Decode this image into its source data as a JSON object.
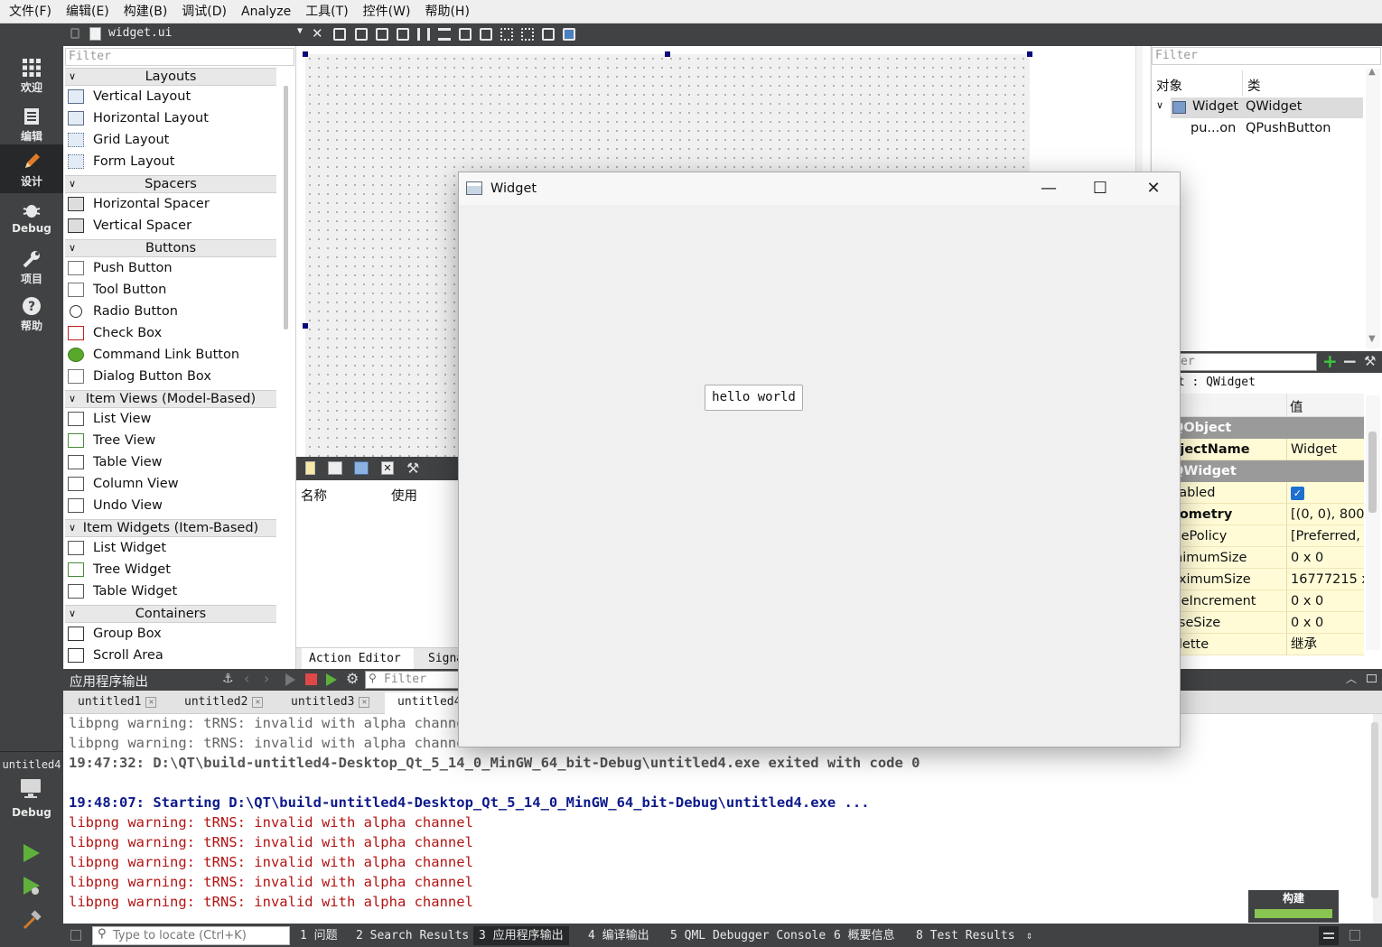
{
  "menu": [
    "文件(F)",
    "编辑(E)",
    "构建(B)",
    "调试(D)",
    "Analyze",
    "工具(T)",
    "控件(W)",
    "帮助(H)"
  ],
  "modes": [
    {
      "label": "欢迎",
      "icon": "grid-icon"
    },
    {
      "label": "编辑",
      "icon": "document-icon"
    },
    {
      "label": "设计",
      "icon": "pencil-icon"
    },
    {
      "label": "Debug",
      "icon": "bug-icon"
    },
    {
      "label": "项目",
      "icon": "wrench-icon"
    },
    {
      "label": "帮助",
      "icon": "help-icon"
    }
  ],
  "kit": {
    "name": "untitled4",
    "label": "Debug"
  },
  "editor": {
    "file": "widget.ui"
  },
  "widget_box": {
    "filter_placeholder": "Filter",
    "categories": {
      "layouts": "Layouts",
      "spacers": "Spacers",
      "buttons": "Buttons",
      "item_views": "Item Views (Model-Based)",
      "item_widgets": "Item Widgets (Item-Based)",
      "containers": "Containers"
    },
    "items": {
      "vertical_layout": "Vertical Layout",
      "horizontal_layout": "Horizontal Layout",
      "grid_layout": "Grid Layout",
      "form_layout": "Form Layout",
      "horizontal_spacer": "Horizontal Spacer",
      "vertical_spacer": "Vertical Spacer",
      "push_button": "Push Button",
      "tool_button": "Tool Button",
      "radio_button": "Radio Button",
      "check_box": "Check Box",
      "command_link_button": "Command Link Button",
      "dialog_button_box": "Dialog Button Box",
      "list_view": "List View",
      "tree_view": "Tree View",
      "table_view": "Table View",
      "column_view": "Column View",
      "undo_view": "Undo View",
      "list_widget": "List Widget",
      "tree_widget": "Tree Widget",
      "table_widget": "Table Widget",
      "group_box": "Group Box",
      "scroll_area": "Scroll Area"
    }
  },
  "action_editor": {
    "col_name": "名称",
    "col_used": "使用",
    "tab_action": "Action Editor",
    "tab_signals": "Signa"
  },
  "object_inspector": {
    "filter_placeholder": "Filter",
    "col_object": "对象",
    "col_class": "类",
    "rows": [
      {
        "object": "Widget",
        "class": "QWidget"
      },
      {
        "object": "pu...on",
        "class": "QPushButton"
      }
    ]
  },
  "property_editor": {
    "filter_fragment": "er",
    "context": "et : QWidget",
    "col_property": "t",
    "col_value": "值",
    "rows": [
      {
        "key": "QObject",
        "section": true
      },
      {
        "key": "bjectName",
        "value": "Widget",
        "bold": true
      },
      {
        "key": "QWidget",
        "section": true
      },
      {
        "key": "nabled",
        "value": "",
        "checked": true
      },
      {
        "key": "eometry",
        "value": "[(0, 0), 800 x",
        "bold": true
      },
      {
        "key": "izePolicy",
        "value": "[Preferred, P"
      },
      {
        "key": "inimumSize",
        "value": "0 x 0"
      },
      {
        "key": "aximumSize",
        "value": "16777215 x"
      },
      {
        "key": "izeIncrement",
        "value": "0 x 0"
      },
      {
        "key": "aseSize",
        "value": "0 x 0"
      },
      {
        "key": "alette",
        "value": "继承"
      }
    ]
  },
  "output": {
    "title": "应用程序输出",
    "filter_placeholder": "Filter",
    "tabs": [
      "untitled1",
      "untitled2",
      "untitled3",
      "untitled4"
    ],
    "lines": [
      {
        "text": "libpng warning: tRNS: invalid with alpha channel",
        "style": "gray-plain"
      },
      {
        "text": "libpng warning: tRNS: invalid with alpha channel",
        "style": "gray-plain"
      },
      {
        "text": "19:47:32: D:\\QT\\build-untitled4-Desktop_Qt_5_14_0_MinGW_64_bit-Debug\\untitled4.exe exited with code 0",
        "style": "gray"
      },
      {
        "text": "",
        "style": "gray"
      },
      {
        "text": "19:48:07: Starting D:\\QT\\build-untitled4-Desktop_Qt_5_14_0_MinGW_64_bit-Debug\\untitled4.exe ...",
        "style": "blue"
      },
      {
        "text": "libpng warning: tRNS: invalid with alpha channel",
        "style": "red"
      },
      {
        "text": "libpng warning: tRNS: invalid with alpha channel",
        "style": "red"
      },
      {
        "text": "libpng warning: tRNS: invalid with alpha channel",
        "style": "red"
      },
      {
        "text": "libpng warning: tRNS: invalid with alpha channel",
        "style": "red"
      },
      {
        "text": "libpng warning: tRNS: invalid with alpha channel",
        "style": "red"
      }
    ]
  },
  "status": {
    "locate_placeholder": "Type to locate (Ctrl+K)",
    "panes": [
      "1 问题",
      "2 Search Results",
      "3 应用程序输出",
      "4 编译输出",
      "5 QML Debugger Console",
      "6 概要信息",
      "8 Test Results"
    ],
    "build_label": "构建",
    "build_progress": 1.0
  },
  "window": {
    "title": "Widget",
    "button_label": "hello world",
    "minimize": "—",
    "maximize": "☐",
    "close": "✕"
  },
  "colors": {
    "chrome_dark": "#404244",
    "active_mode": "#262829",
    "property_bg": "#fffbd6",
    "warning_red": "#b31414",
    "start_blue": "#0d1a8a",
    "build_green": "#8ac552"
  }
}
